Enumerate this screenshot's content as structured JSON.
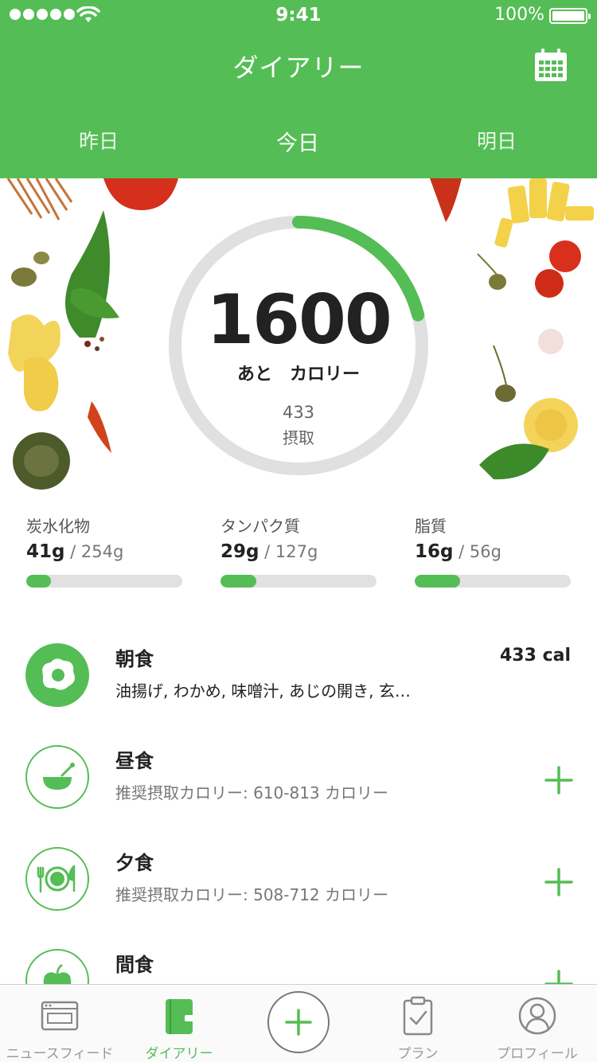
{
  "colors": {
    "accent": "#55bd55",
    "ring_track": "#e0e0e0",
    "bar_track": "#e1e1e1"
  },
  "status_bar": {
    "time": "9:41",
    "battery": "100%",
    "icons": [
      "signal-dots",
      "wifi-icon",
      "battery-icon"
    ]
  },
  "header": {
    "title": "ダイアリー",
    "calendar_icon": "calendar-icon",
    "days": [
      "昨日",
      "今日",
      "明日"
    ],
    "selected_day": "今日"
  },
  "summary": {
    "remaining": "1600",
    "remaining_label": "あと　カロリー",
    "consumed": "433",
    "consumed_label": "摂取",
    "progress_fraction": 0.21
  },
  "macros": [
    {
      "name": "炭水化物",
      "value": "41g",
      "goal": "/ 254g",
      "fraction": 0.16
    },
    {
      "name": "タンパク質",
      "value": "29g",
      "goal": "/ 127g",
      "fraction": 0.23
    },
    {
      "name": "脂質",
      "value": "16g",
      "goal": "/ 56g",
      "fraction": 0.29
    }
  ],
  "meals": [
    {
      "name": "朝食",
      "detail": "油揚げ, わかめ, 味噌汁, あじの開き, 玄…",
      "calories": "433 cal",
      "icon": "fried-egg-icon"
    },
    {
      "name": "昼食",
      "detail": "推奨摂取カロリー: 610-813 カロリー",
      "icon": "bowl-icon",
      "action": "add-icon"
    },
    {
      "name": "夕食",
      "detail": "推奨摂取カロリー: 508-712 カロリー",
      "icon": "plate-cutlery-icon",
      "action": "add-icon"
    },
    {
      "name": "間食",
      "icon": "apple-icon",
      "action": "add-icon"
    }
  ],
  "tabbar": {
    "items": [
      {
        "label": "ニュースフィード",
        "icon": "newsfeed-icon"
      },
      {
        "label": "ダイアリー",
        "icon": "diary-icon",
        "active": true
      },
      {
        "label": "",
        "icon": "add-icon"
      },
      {
        "label": "プラン",
        "icon": "clipboard-icon"
      },
      {
        "label": "プロフィール",
        "icon": "profile-icon"
      }
    ]
  }
}
